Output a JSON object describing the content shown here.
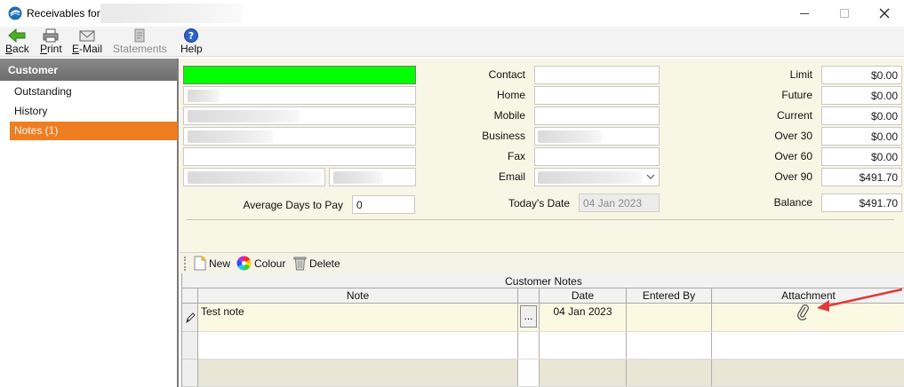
{
  "window": {
    "title": "Receivables for"
  },
  "toolbar": {
    "back": {
      "accel": "B",
      "rest": "ack"
    },
    "print": {
      "accel": "P",
      "rest": "rint"
    },
    "email": {
      "accel": "E",
      "rest": "-Mail"
    },
    "statements": {
      "label": "Statements"
    },
    "help": {
      "label": "Help"
    }
  },
  "nav": {
    "header": "Customer",
    "items": [
      {
        "label": "Outstanding"
      },
      {
        "label": "History"
      },
      {
        "label": "Notes (1)"
      }
    ],
    "active_index": 2
  },
  "contact_fields": [
    {
      "label": "Contact",
      "value": ""
    },
    {
      "label": "Home",
      "value": ""
    },
    {
      "label": "Mobile",
      "value": ""
    },
    {
      "label": "Business",
      "value": ""
    },
    {
      "label": "Fax",
      "value": ""
    },
    {
      "label": "Email",
      "value": ""
    }
  ],
  "balances": [
    {
      "label": "Limit",
      "value": "$0.00"
    },
    {
      "label": "Future",
      "value": "$0.00"
    },
    {
      "label": "Current",
      "value": "$0.00"
    },
    {
      "label": "Over 30",
      "value": "$0.00"
    },
    {
      "label": "Over 60",
      "value": "$0.00"
    },
    {
      "label": "Over 90",
      "value": "$491.70"
    },
    {
      "label": "Balance",
      "value": "$491.70"
    }
  ],
  "avg_days": {
    "label": "Average Days to Pay",
    "value": "0"
  },
  "today": {
    "label": "Today's Date",
    "value": "04 Jan 2023"
  },
  "notes_toolbar": {
    "new": "New",
    "colour": "Colour",
    "delete": "Delete"
  },
  "notes_grid": {
    "caption": "Customer Notes",
    "columns": [
      "Note",
      "Date",
      "Entered By",
      "Attachment"
    ],
    "ellipsis": "...",
    "rows": [
      {
        "note": "Test note",
        "date": "04 Jan 2023",
        "entered_by": "",
        "has_attachment": true
      }
    ]
  },
  "colors": {
    "accent": "#ef7d22",
    "customer_indicator": "#00ff00",
    "panel": "#f8f6e4",
    "annotation_arrow": "#e03a3a"
  },
  "icons": [
    "app-icon",
    "back-arrow-icon",
    "printer-icon",
    "envelope-icon",
    "statements-icon",
    "help-icon",
    "new-note-icon",
    "colour-wheel-icon",
    "trash-icon",
    "pencil-icon",
    "paperclip-icon",
    "chevron-down-icon"
  ]
}
